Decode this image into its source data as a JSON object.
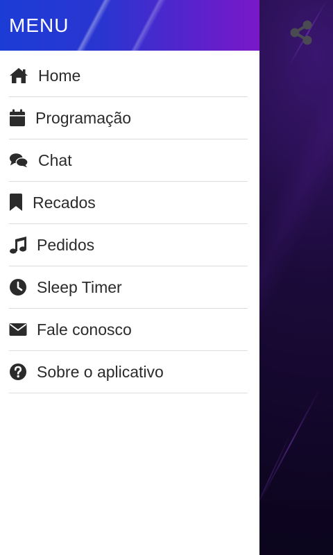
{
  "drawer": {
    "title": "MENU",
    "items": [
      {
        "label": "Home",
        "icon": "home-icon"
      },
      {
        "label": "Programação",
        "icon": "calendar-icon"
      },
      {
        "label": "Chat",
        "icon": "chat-icon"
      },
      {
        "label": "Recados",
        "icon": "bookmark-icon"
      },
      {
        "label": "Pedidos",
        "icon": "music-icon"
      },
      {
        "label": "Sleep Timer",
        "icon": "clock-icon"
      },
      {
        "label": "Fale conosco",
        "icon": "envelope-icon"
      },
      {
        "label": "Sobre o aplicativo",
        "icon": "question-circle-icon"
      }
    ]
  },
  "app": {
    "share_icon": "share-icon"
  },
  "colors": {
    "header_gradient_start": "#1c3cd6",
    "header_gradient_end": "#7a18c8",
    "icon_color": "#2b2b2b",
    "background_dark": "#0d0520"
  }
}
